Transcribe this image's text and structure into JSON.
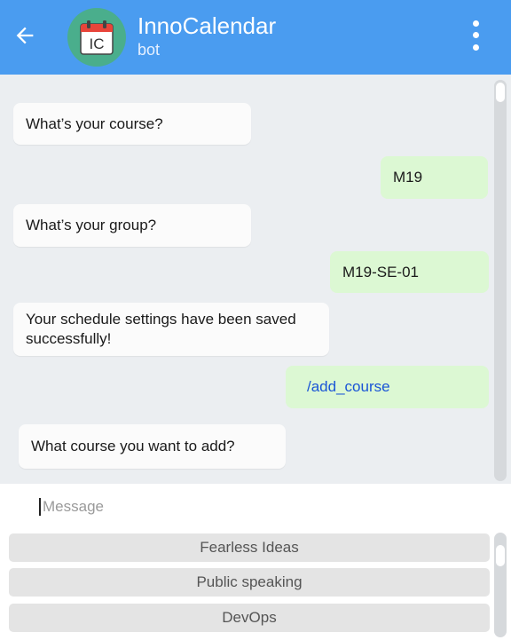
{
  "header": {
    "title": "InnoCalendar",
    "subtitle": "bot",
    "avatar_text": "IC",
    "color": "#4a9cf0",
    "avatar_color": "#4aae8c"
  },
  "messages": [
    {
      "from": "bot",
      "text": "What’s your course?"
    },
    {
      "from": "user",
      "text": "M19"
    },
    {
      "from": "bot",
      "text": "What’s your group?"
    },
    {
      "from": "user",
      "text": "M19-SE-01"
    },
    {
      "from": "bot",
      "text": "Your schedule settings have been saved successfully!"
    },
    {
      "from": "user",
      "text": "/add_course"
    },
    {
      "from": "bot",
      "text": "What course you want to add?"
    }
  ],
  "input": {
    "placeholder": "Message",
    "value": ""
  },
  "keyboard": {
    "buttons": [
      "Fearless Ideas",
      "Public speaking",
      "DevOps"
    ]
  },
  "icons": {
    "back": "arrow-left-icon",
    "menu": "more-vertical-icon",
    "avatar": "calendar-icon"
  },
  "colors": {
    "chat_background": "#ebeef1",
    "incoming_bubble": "#fbfbfb",
    "outgoing_bubble": "#dcf8d3",
    "command_link": "#1a55d6",
    "keyboard_button": "#e4e4e4"
  }
}
